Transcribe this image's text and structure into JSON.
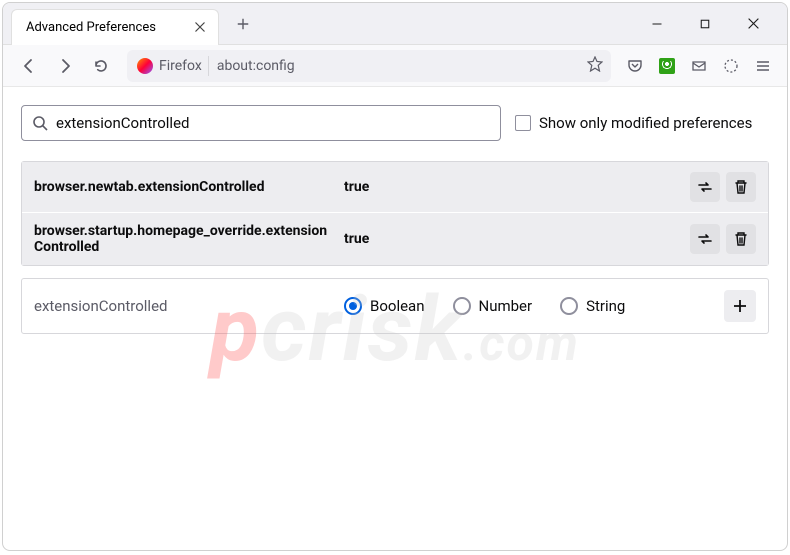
{
  "window": {
    "tab_title": "Advanced Preferences"
  },
  "url_bar": {
    "identity_label": "Firefox",
    "address": "about:config"
  },
  "search": {
    "value": "extensionControlled",
    "only_modified_label": "Show only modified preferences"
  },
  "preferences": [
    {
      "name": "browser.newtab.extensionControlled",
      "value": "true"
    },
    {
      "name": "browser.startup.homepage_override.extensionControlled",
      "value": "true"
    }
  ],
  "new_pref": {
    "name": "extensionControlled",
    "type_options": [
      "Boolean",
      "Number",
      "String"
    ],
    "selected_type": "Boolean"
  },
  "watermark": "pcrisk.com"
}
